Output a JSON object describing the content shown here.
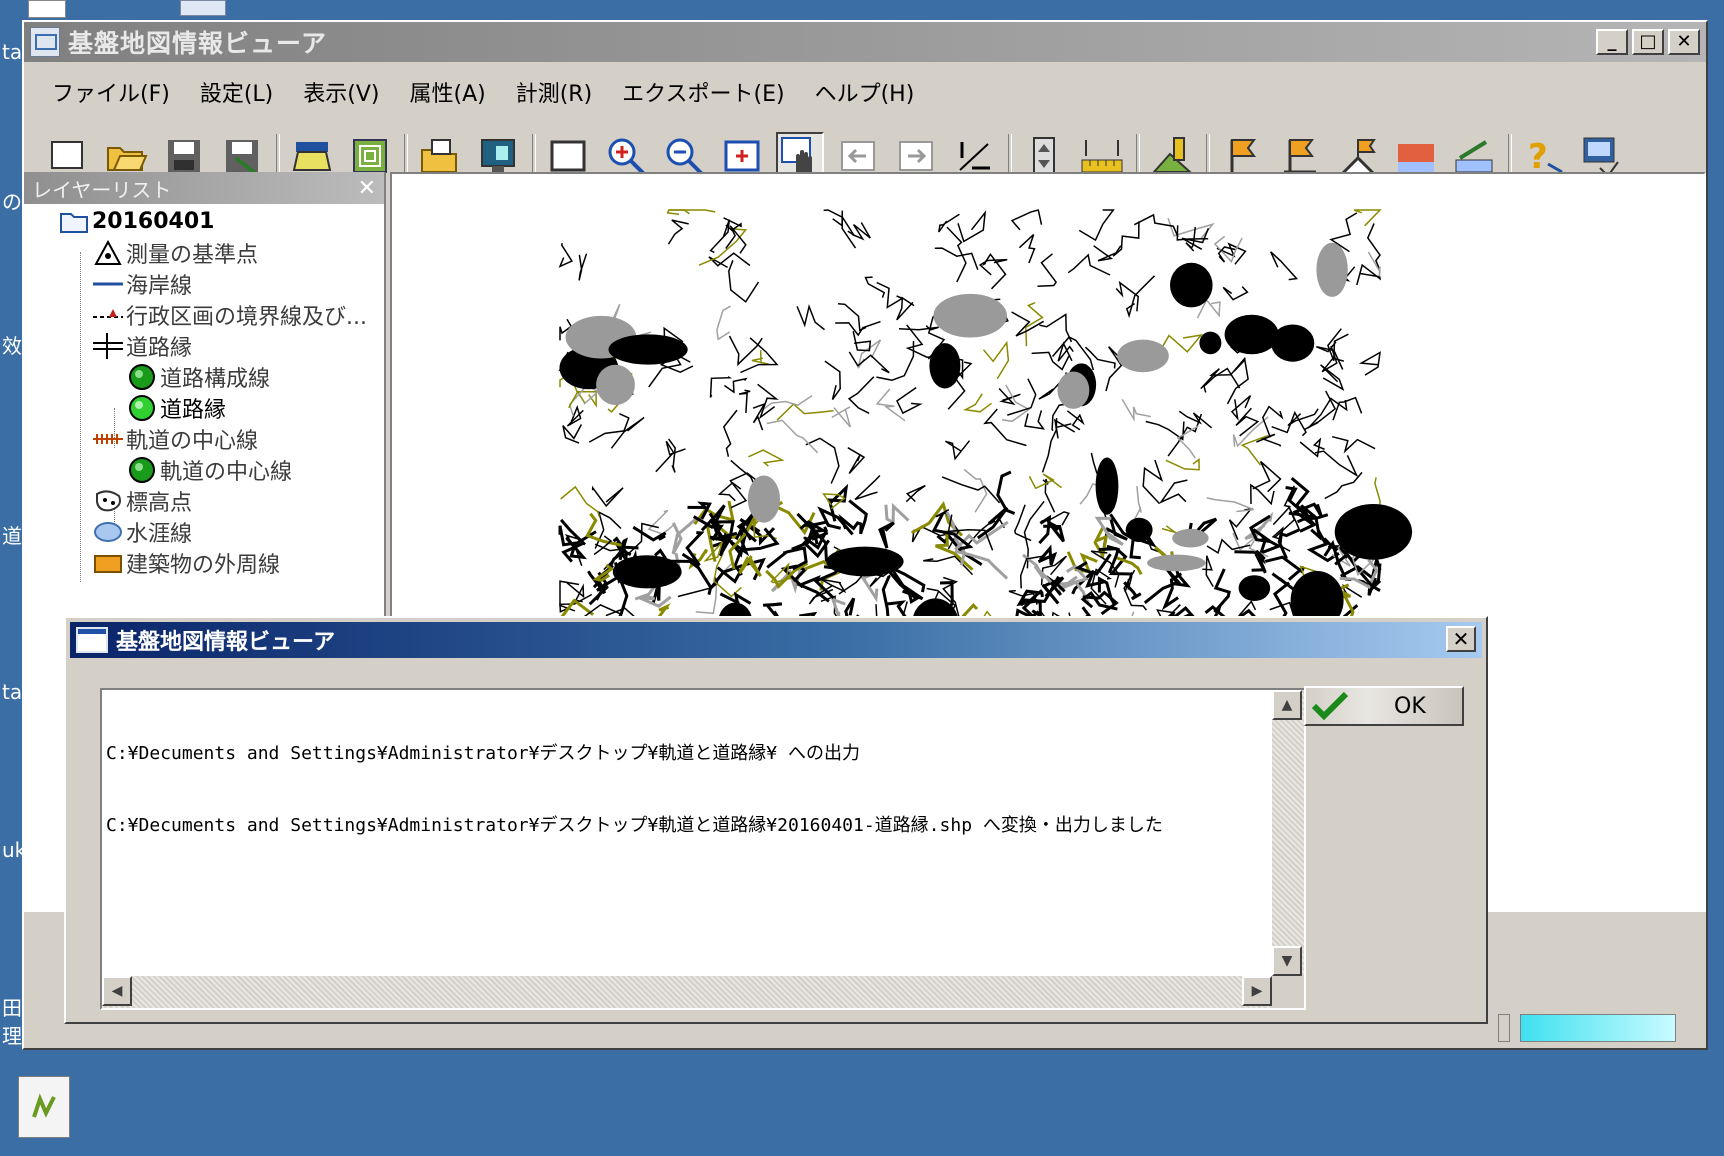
{
  "desktop": {
    "side_glyphs": [
      "ta",
      "の",
      "效",
      "道",
      "ta",
      "uk",
      "田",
      "理"
    ]
  },
  "window": {
    "title": "基盤地図情報ビューア",
    "controls": {
      "minimize": "_",
      "maximize": "□",
      "close": "✕"
    }
  },
  "menu": [
    {
      "label": "ファイル(F)"
    },
    {
      "label": "設定(L)"
    },
    {
      "label": "表示(V)"
    },
    {
      "label": "属性(A)"
    },
    {
      "label": "計測(R)"
    },
    {
      "label": "エクスポート(E)"
    },
    {
      "label": "ヘルプ(H)"
    }
  ],
  "toolbar_icons": [
    "new-file-icon",
    "open-folder-icon",
    "save-icon",
    "save-as-icon",
    "print-icon",
    "layers-icon",
    "import-icon",
    "display-icon",
    "full-extent-icon",
    "zoom-in-icon",
    "zoom-out-icon",
    "center-icon",
    "pan-hand-icon",
    "back-icon",
    "forward-icon",
    "scale-icon",
    "vertical-scale-icon",
    "ruler-icon",
    "elevation-icon",
    "flag1-icon",
    "flag2-icon",
    "flag3-icon",
    "profile-icon",
    "measure-icon",
    "help-icon",
    "version-icon"
  ],
  "layer_panel": {
    "title": "レイヤーリスト",
    "close": "✕",
    "root": "20160401",
    "items": [
      {
        "label": "測量の基準点",
        "icon": "survey-point-icon",
        "level": 1
      },
      {
        "label": "海岸線",
        "icon": "coastline-icon",
        "level": 1
      },
      {
        "label": "行政区画の境界線及び...",
        "icon": "admin-boundary-icon",
        "level": 1
      },
      {
        "label": "道路縁",
        "icon": "road-edge-icon",
        "level": 1
      },
      {
        "label": "道路構成線",
        "icon": "green-dot-icon",
        "level": 2
      },
      {
        "label": "道路縁",
        "icon": "green-dot-icon",
        "level": 2
      },
      {
        "label": "軌道の中心線",
        "icon": "railway-icon",
        "level": 1
      },
      {
        "label": "軌道の中心線",
        "icon": "green-dot-icon",
        "level": 2
      },
      {
        "label": "標高点",
        "icon": "elevation-point-icon",
        "level": 1
      },
      {
        "label": "水涯線",
        "icon": "waterline-icon",
        "level": 1
      },
      {
        "label": "建築物の外周線",
        "icon": "building-icon",
        "level": 1
      }
    ]
  },
  "dialog": {
    "title": "基盤地図情報ビューア",
    "close": "✕",
    "ok_label": "OK",
    "lines": [
      "C:¥Decuments and Settings¥Administrator¥デスクトップ¥軌道と道路縁¥ への出力",
      "C:¥Decuments and Settings¥Administrator¥デスクトップ¥軌道と道路縁¥20160401-道路縁.shp へ変換・出力しました"
    ]
  },
  "colors": {
    "desktop": "#3a6ea5",
    "dialog_title_start": "#0a246a",
    "road_line": "#8a8a00",
    "green_dot": "#1ea81e"
  }
}
